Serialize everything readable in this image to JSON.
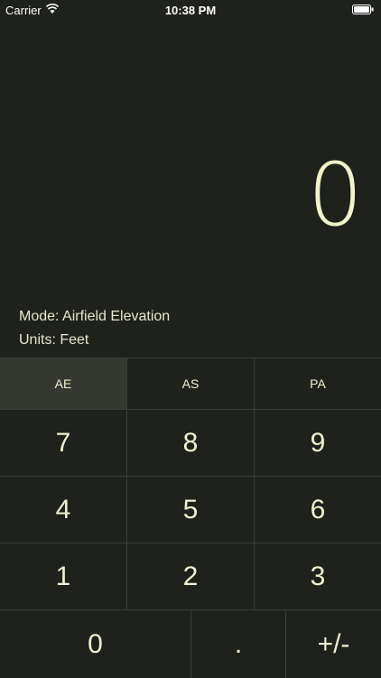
{
  "status": {
    "carrier": "Carrier",
    "time": "10:38 PM"
  },
  "display": {
    "value": "0"
  },
  "info": {
    "mode": "Mode: Airfield Elevation",
    "units": "Units: Feet"
  },
  "mode_keys": [
    "AE",
    "AS",
    "PA"
  ],
  "keys": {
    "r1": [
      "7",
      "8",
      "9"
    ],
    "r2": [
      "4",
      "5",
      "6"
    ],
    "r3": [
      "1",
      "2",
      "3"
    ],
    "r4": [
      "0",
      ".",
      "+/-"
    ]
  },
  "icons": {
    "wifi": "wifi-icon",
    "battery": "battery-icon"
  },
  "colors": {
    "background": "#1f211d",
    "active_key": "#353731",
    "text": "#ececcc"
  }
}
